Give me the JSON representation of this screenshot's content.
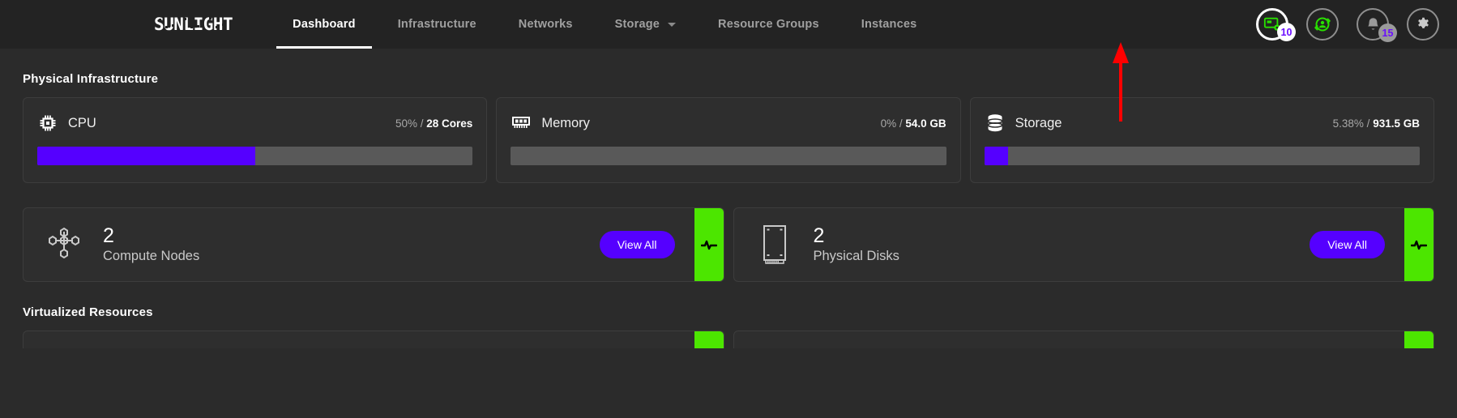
{
  "brand": {
    "logo_text": "SUNLIGHT"
  },
  "nav": {
    "items": [
      {
        "label": "Dashboard",
        "active": true,
        "has_caret": false
      },
      {
        "label": "Infrastructure",
        "active": false,
        "has_caret": false
      },
      {
        "label": "Networks",
        "active": false,
        "has_caret": false
      },
      {
        "label": "Storage",
        "active": false,
        "has_caret": true
      },
      {
        "label": "Resource Groups",
        "active": false,
        "has_caret": false
      },
      {
        "label": "Instances",
        "active": false,
        "has_caret": false
      }
    ]
  },
  "topicons": {
    "vm_badge": "10",
    "user_badge": "",
    "bell_badge": "15",
    "settings_badge": ""
  },
  "sections": {
    "physical": "Physical Infrastructure",
    "virtualized": "Virtualized Resources"
  },
  "resources": [
    {
      "name": "CPU",
      "percent_text": "50% /",
      "total": "28 Cores",
      "fill_pct": 50,
      "icon": "cpu-chip-icon"
    },
    {
      "name": "Memory",
      "percent_text": "0% /",
      "total": "54.0 GB",
      "fill_pct": 0,
      "icon": "memory-stick-icon"
    },
    {
      "name": "Storage",
      "percent_text": "5.38% /",
      "total": "931.5 GB",
      "fill_pct": 5.38,
      "icon": "database-cylinder-icon"
    }
  ],
  "counts": [
    {
      "number": "2",
      "label": "Compute Nodes",
      "button": "View All",
      "icon": "node-topology-icon"
    },
    {
      "number": "2",
      "label": "Physical Disks",
      "button": "View All",
      "icon": "disk-drive-icon"
    }
  ],
  "colors": {
    "accent_purple": "#5500ff",
    "health_green": "#4ce600",
    "page_bg": "#2b2b2b",
    "topbar_bg": "#232323",
    "card_bg": "#2e2e2e",
    "bar_track": "#595959",
    "annotation_red": "#ff0000"
  }
}
